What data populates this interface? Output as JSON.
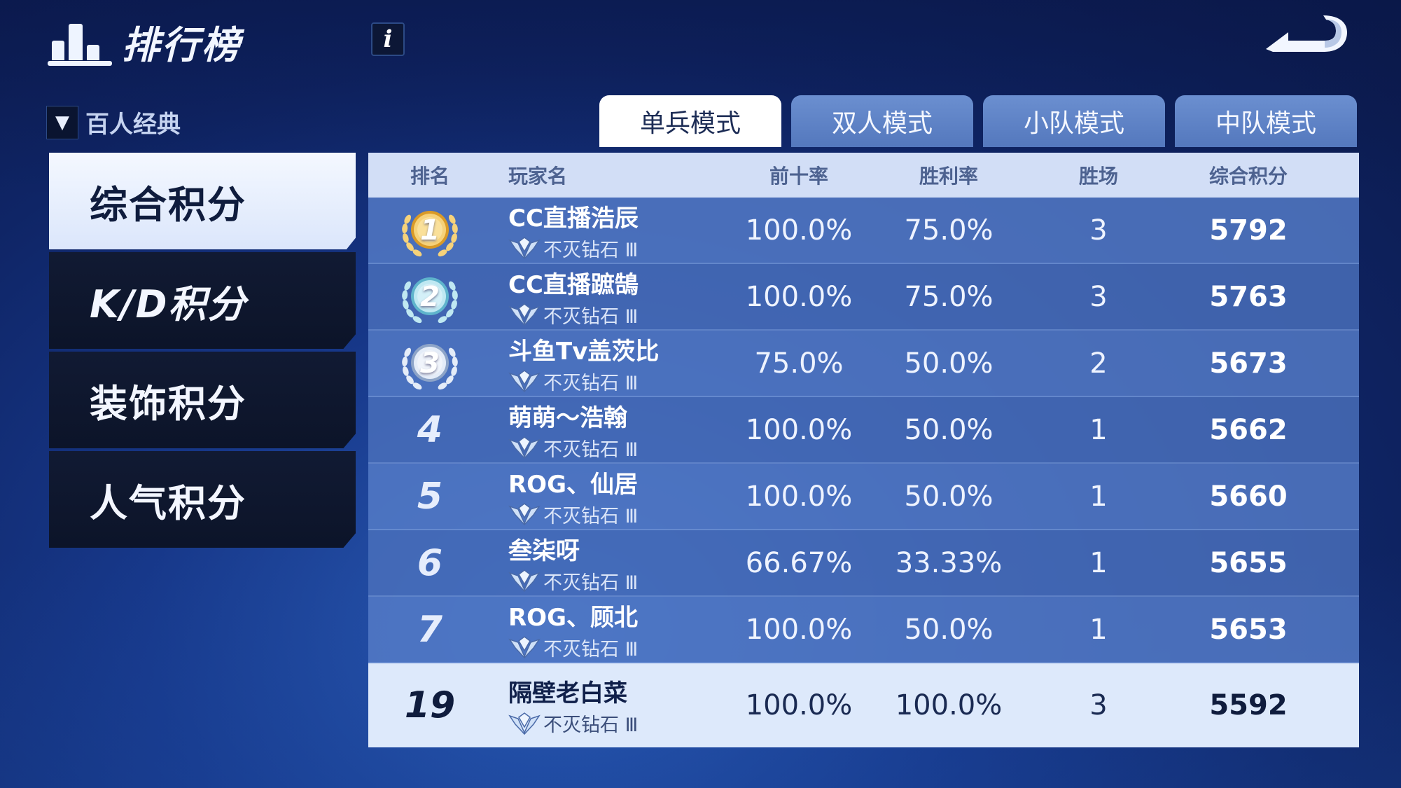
{
  "header": {
    "title": "排行榜",
    "info_label": "i"
  },
  "mode_selector": {
    "arrow": "▼",
    "label": "百人经典"
  },
  "menu": [
    {
      "label": "综合积分",
      "active": true
    },
    {
      "label": "K/D积分",
      "active": false
    },
    {
      "label": "装饰积分",
      "active": false
    },
    {
      "label": "人气积分",
      "active": false
    }
  ],
  "tabs": [
    {
      "label": "单兵模式",
      "active": true
    },
    {
      "label": "双人模式",
      "active": false
    },
    {
      "label": "小队模式",
      "active": false
    },
    {
      "label": "中队模式",
      "active": false
    }
  ],
  "table": {
    "columns": [
      "排名",
      "玩家名",
      "前十率",
      "胜利率",
      "胜场",
      "综合积分"
    ],
    "rows": [
      {
        "rank": "1",
        "name": "CC直播浩辰",
        "tier": "不灭钻石 Ⅲ",
        "top10": "100.0%",
        "winrate": "75.0%",
        "wins": "3",
        "score": "5792"
      },
      {
        "rank": "2",
        "name": "CC直播蹠鵠",
        "tier": "不灭钻石 Ⅲ",
        "top10": "100.0%",
        "winrate": "75.0%",
        "wins": "3",
        "score": "5763"
      },
      {
        "rank": "3",
        "name": "斗鱼Tv盖茨比",
        "tier": "不灭钻石 Ⅲ",
        "top10": "75.0%",
        "winrate": "50.0%",
        "wins": "2",
        "score": "5673"
      },
      {
        "rank": "4",
        "name": "萌萌～浩翰",
        "tier": "不灭钻石 Ⅲ",
        "top10": "100.0%",
        "winrate": "50.0%",
        "wins": "1",
        "score": "5662"
      },
      {
        "rank": "5",
        "name": "ROG、仙居",
        "tier": "不灭钻石 Ⅲ",
        "top10": "100.0%",
        "winrate": "50.0%",
        "wins": "1",
        "score": "5660"
      },
      {
        "rank": "6",
        "name": "叁柒呀",
        "tier": "不灭钻石 Ⅲ",
        "top10": "66.67%",
        "winrate": "33.33%",
        "wins": "1",
        "score": "5655"
      },
      {
        "rank": "7",
        "name": "ROG、顾北",
        "tier": "不灭钻石 Ⅲ",
        "top10": "100.0%",
        "winrate": "50.0%",
        "wins": "1",
        "score": "5653"
      }
    ],
    "me": {
      "rank": "19",
      "name": "隔壁老白菜",
      "tier": "不灭钻石 Ⅲ",
      "top10": "100.0%",
      "winrate": "100.0%",
      "wins": "3",
      "score": "5592"
    }
  },
  "colors": {
    "gold": "#f2c24b",
    "silver": "#a9d9ea",
    "bronze": "#c9d6ec"
  }
}
